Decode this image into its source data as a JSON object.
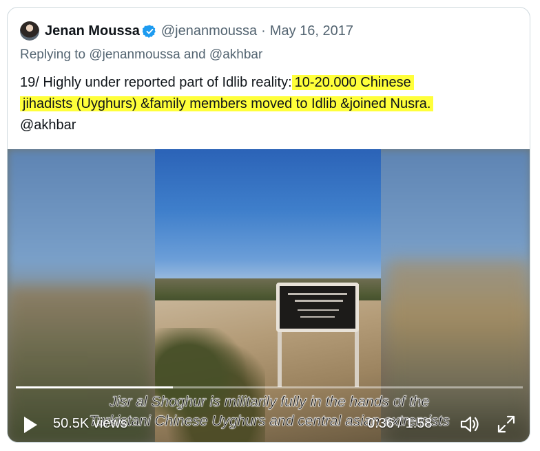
{
  "tweet": {
    "author_name": "Jenan Moussa",
    "handle": "@jenanmoussa",
    "separator": "·",
    "date": "May 16, 2017",
    "replying_prefix": "Replying to ",
    "reply_mention_1": "@jenanmoussa",
    "reply_and": " and ",
    "reply_mention_2": "@akhbar",
    "text_plain": "19/ Highly under reported part of Idlib reality:",
    "text_highlight_1": "10-20.000 Chinese",
    "text_highlight_2": "jihadists (Uyghurs) &family members moved to Idlib &joined Nusra.",
    "text_mention": "@akhbar",
    "highlight_color": "#ffff3a",
    "verified_color": "#1d9bf0"
  },
  "video": {
    "subtitle_line_1": "Jisr al Shoghur is militarily fully in the hands of the",
    "subtitle_line_2": "Turkistani Chinese Uyghurs and central asian extremists",
    "views": "50.5K views",
    "time": "0:36 / 1:58",
    "progress_fraction": 0.31,
    "icons": [
      "play-icon",
      "volume-icon",
      "fullscreen-icon"
    ]
  }
}
